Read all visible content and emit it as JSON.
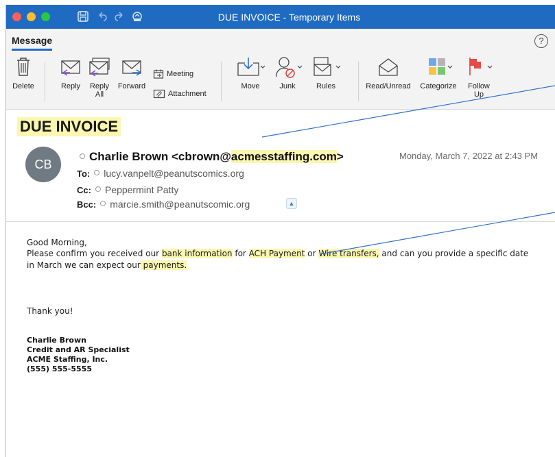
{
  "window": {
    "title": "DUE INVOICE - Temporary Items"
  },
  "ribbon": {
    "tab": "Message",
    "help": "?",
    "buttons": {
      "delete": "Delete",
      "reply": "Reply",
      "reply_all_1": "Reply",
      "reply_all_2": "All",
      "forward": "Forward",
      "meeting": "Meeting",
      "attachment": "Attachment",
      "move": "Move",
      "junk": "Junk",
      "rules": "Rules",
      "read_unread": "Read/Unread",
      "categorize": "Categorize",
      "follow_up_1": "Follow",
      "follow_up_2": "Up"
    }
  },
  "message": {
    "subject": "DUE INVOICE",
    "avatar_initials": "CB",
    "from_name": "Charlie Brown <cbrown@",
    "from_domain": "acmesstaffing.com",
    "from_end": ">",
    "date": "Monday, March 7, 2022 at 2:43 PM",
    "to_label": "To:",
    "to": "lucy.vanpelt@peanutscomics.org",
    "cc_label": "Cc:",
    "cc": "Peppermint Patty",
    "bcc_label": "Bcc:",
    "bcc": "marcie.smith@peanutscomic.org"
  },
  "body": {
    "greeting": "Good Morning,",
    "p1_a": "Please confirm you received our ",
    "p1_hl1": "bank information",
    "p1_b": " for ",
    "p1_hl2": "ACH Payment",
    "p1_c": " or ",
    "p1_hl3": "Wire transfers,",
    "p1_d": " and can you provide a specific date",
    "p2_a": "in March we can expect our",
    "p2_hl": " payments.",
    "thanks": "Thank you!",
    "sig_name": "Charlie Brown",
    "sig_title": "Credit and AR Specialist",
    "sig_company": "ACME Staffing, Inc.",
    "sig_phone": "(555) 555-5555"
  },
  "colors": {
    "titlebar": "#1f6bc2",
    "highlight": "#fbf6b0",
    "annotation_line": "#2f6fd0"
  }
}
